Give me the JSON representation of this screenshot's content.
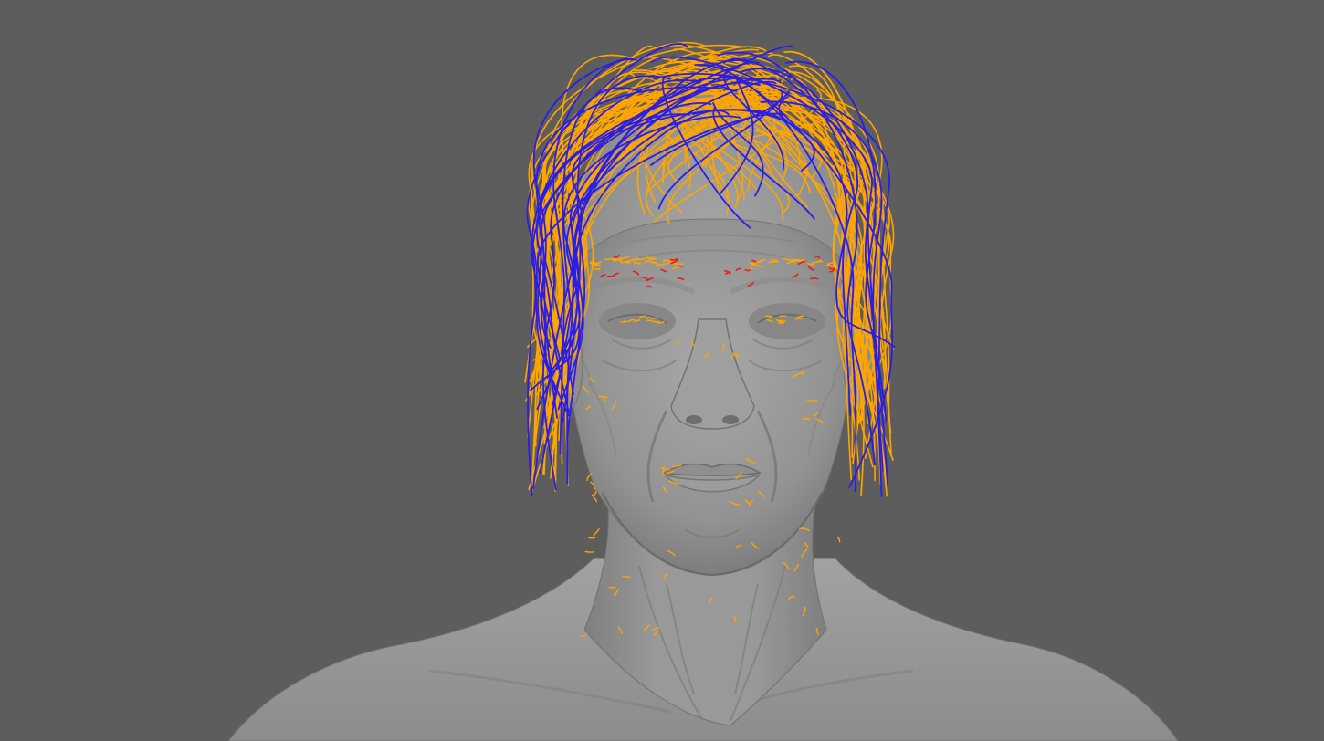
{
  "viewport": {
    "background": "#5d5d5d",
    "mesh_color": "#9a9a9a",
    "mesh_shadow": "#6e6e6e",
    "mesh_highlight": "#b4b4b4"
  },
  "guide_curves": {
    "primary_color": "#ffa500",
    "secondary_color": "#2a1ee6",
    "accent_color": "#e81c1c"
  }
}
